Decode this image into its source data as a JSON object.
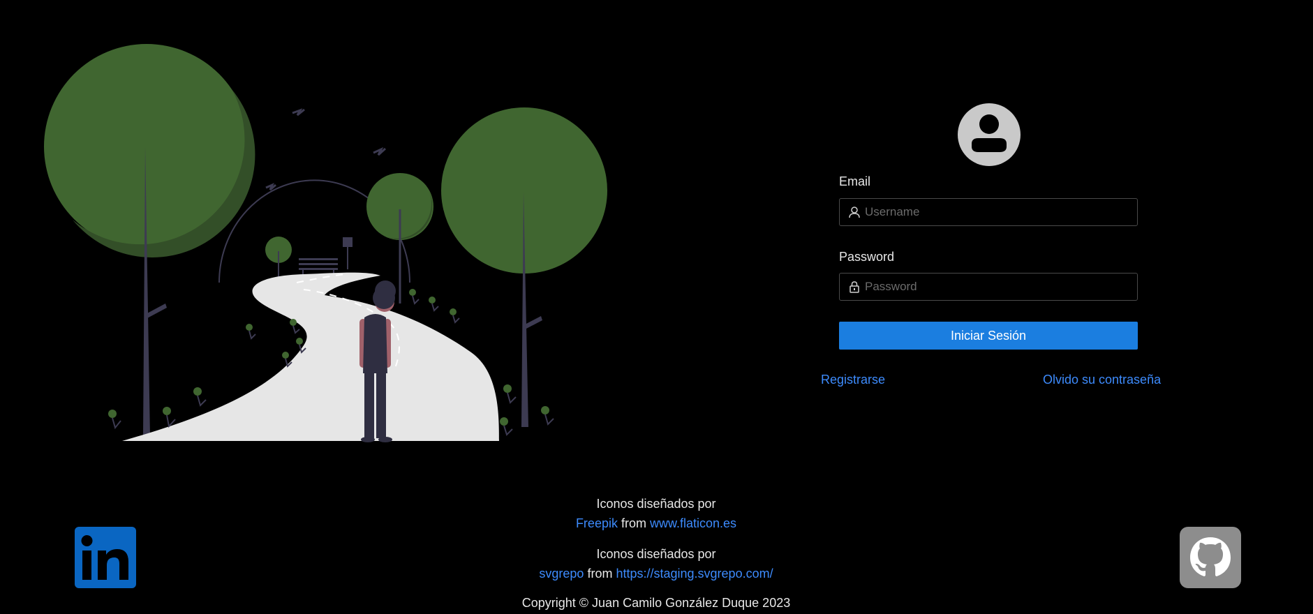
{
  "login": {
    "email_label": "Email",
    "email_placeholder": "Username",
    "password_label": "Password",
    "password_placeholder": "Password",
    "submit_label": "Iniciar Sesión",
    "register_link": "Registrarse",
    "forgot_link": "Olvido su contraseña"
  },
  "credits": {
    "line1_text": "Iconos diseñados por",
    "line1_author": "Freepik",
    "line1_from": "from",
    "line1_site": "www.flaticon.es",
    "line2_text": "Iconos diseñados por",
    "line2_author": "svgrepo",
    "line2_from": "from",
    "line2_site": "https://staging.svgrepo.com/",
    "copyright": "Copyright © Juan Camilo González Duque 2023"
  },
  "icons": {
    "avatar": "user-circle-icon",
    "email_field": "user-icon",
    "password_field": "lock-icon",
    "linkedin": "linkedin-icon",
    "github": "github-icon"
  },
  "colors": {
    "background": "#000000",
    "primary_button": "#1b7ee0",
    "link": "#3d8bfd",
    "tree_green": "#406630",
    "path": "#e6e6e6"
  }
}
